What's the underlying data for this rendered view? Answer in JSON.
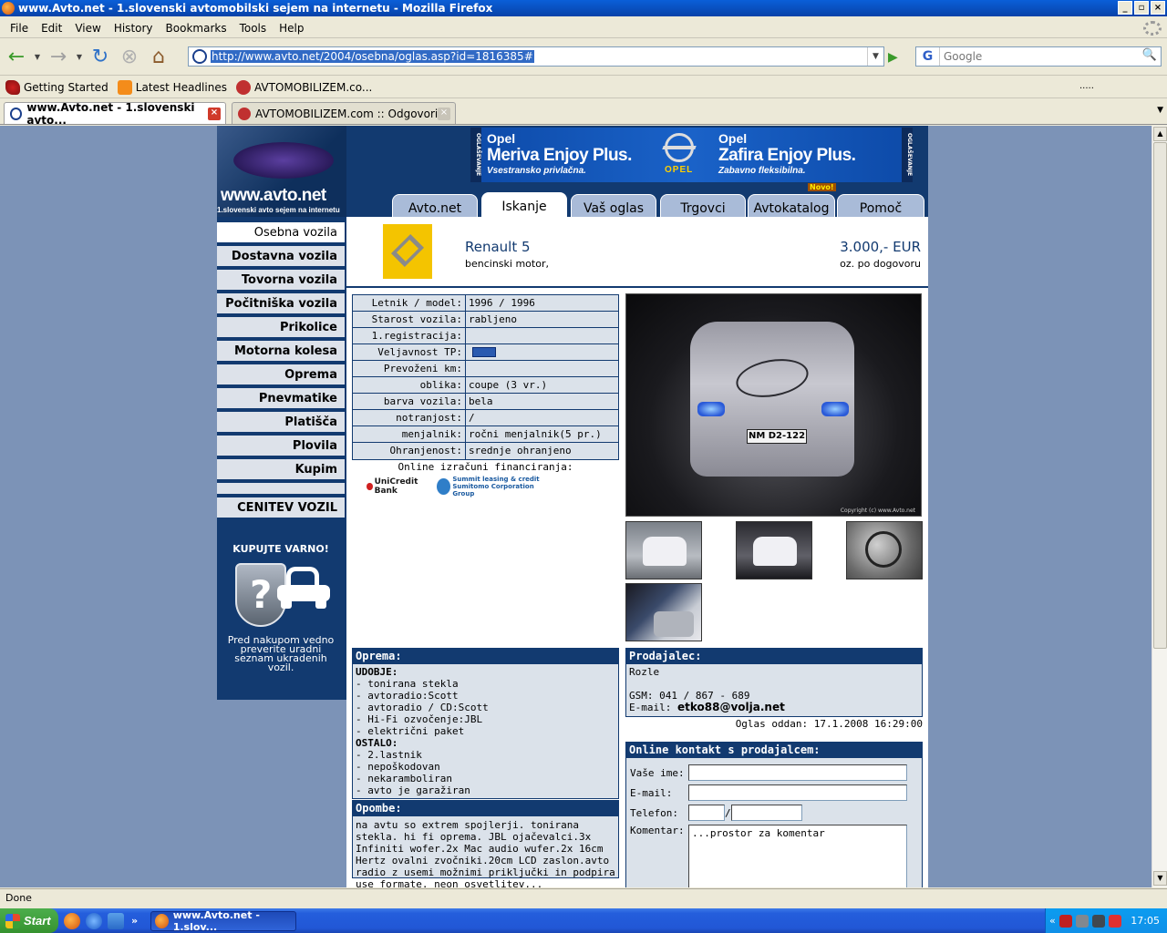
{
  "window": {
    "title": "www.Avto.net - 1.slovenski avtomobilski sejem na internetu - Mozilla Firefox",
    "min": "_",
    "max": "▫",
    "close": "×"
  },
  "menu": [
    "File",
    "Edit",
    "View",
    "History",
    "Bookmarks",
    "Tools",
    "Help"
  ],
  "nav": {
    "url": "http://www.avto.net/2004/osebna/oglas.asp?id=1816385#",
    "search_placeholder": "Google"
  },
  "bookmarks": [
    "Getting Started",
    "Latest Headlines",
    "AVTOMOBILIZEM.co..."
  ],
  "bookmarks_more": ".....",
  "browser_tabs": [
    {
      "label": "www.Avto.net - 1.slovenski avto...",
      "active": true
    },
    {
      "label": "AVTOMOBILIZEM.com :: Odgovori",
      "active": false
    }
  ],
  "site": {
    "logo_title": "www.avto.net",
    "logo_sub": "1.slovenski avto sejem na internetu",
    "banner": {
      "side_label": "OGLAŠEVANJE",
      "left": {
        "brand": "Opel",
        "model": "Meriva Enjoy Plus.",
        "tagline": "Vsestransko privlačna."
      },
      "right": {
        "brand": "Opel",
        "model": "Zafira Enjoy Plus.",
        "tagline": "Zabavno fleksibilna."
      },
      "logo_text": "OPEL"
    },
    "tabs": [
      "Avto.net",
      "Iskanje",
      "Vaš oglas",
      "Trgovci",
      "Avtokatalog",
      "Pomoč"
    ],
    "nova_badge": "Novo!",
    "sidebar": [
      "Osebna vozila",
      "Dostavna vozila",
      "Tovorna vozila",
      "Počitniška vozila",
      "Prikolice",
      "Motorna kolesa",
      "Oprema",
      "Pnevmatike",
      "Platišča",
      "Plovila",
      "Kupim",
      "",
      "CENITEV VOZIL"
    ],
    "promo": {
      "title": "KUPUJTE VARNO!",
      "text": "Pred nakupom vedno preverite uradni seznam ukradenih vozil."
    }
  },
  "listing": {
    "title": "Renault 5",
    "subtitle": "bencinski motor,",
    "price": "3.000,- EUR",
    "price_note": "oz. po dogovoru",
    "specs": [
      {
        "label": "Letnik / model:",
        "value": "1996 / 1996"
      },
      {
        "label": "Starost vozila:",
        "value": "rabljeno"
      },
      {
        "label": "1.registracija:",
        "value": ""
      },
      {
        "label": "Veljavnost TP:",
        "value": ""
      },
      {
        "label": "Prevoženi km:",
        "value": ""
      },
      {
        "label": "oblika:",
        "value": "coupe (3 vr.)"
      },
      {
        "label": "barva vozila:",
        "value": "bela"
      },
      {
        "label": "notranjost:",
        "value": "/"
      },
      {
        "label": "menjalnik:",
        "value": "ročni menjalnik(5 pr.)"
      },
      {
        "label": "Ohranjenost:",
        "value": "srednje ohranjeno"
      }
    ],
    "financing_title": "Online izračuni financiranja:",
    "financing_banks": {
      "unicredit": "UniCredit Bank",
      "summit_1": "Summit leasing & credit",
      "summit_2": "Sumitomo Corporation Group"
    },
    "photo_plate": "NM  D2-122",
    "photo_copyright": "Copyright (c) www.Avto.net",
    "oprema": {
      "heading": "Oprema:",
      "group1_title": "UDOBJE:",
      "group1": [
        "- tonirana stekla",
        "- avtoradio:Scott",
        "- avtoradio / CD:Scott",
        "- Hi-Fi ozvočenje:JBL",
        "- električni paket"
      ],
      "group2_title": "OSTALO:",
      "group2": [
        "- 2.lastnik",
        "- nepoškodovan",
        "- nekaramboliran",
        "- avto je garažiran"
      ]
    },
    "opombe": {
      "heading": "Opombe:",
      "text": "na avtu so extrem spojlerji. tonirana stekla. hi fi oprema. JBL ojačevalci.3x Infiniti wofer.2x Mac audio wufer.2x 16cm Hertz ovalni zvočniki.20cm LCD zaslon.avto radio z usemi možnimi priključki in podpira use formate. neon osvetlitev..."
    },
    "seller": {
      "heading": "Prodajalec:",
      "name": "Rozle",
      "gsm": "GSM: 041 / 867 - 689",
      "email_label": "E-mail:",
      "email": "etko88@volja.net"
    },
    "posted": "Oglas oddan: 17.1.2008 16:29:00",
    "contact": {
      "heading": "Online kontakt s prodajalcem:",
      "name_label": "Vaše ime:",
      "email_label": "E-mail:",
      "phone_label": "Telefon:",
      "phone_sep": "/",
      "comment_label": "Komentar:",
      "comment_value": "...prostor za komentar"
    }
  },
  "status": "Done",
  "taskbar": {
    "start": "Start",
    "quicklaunch_more": "»",
    "task": "www.Avto.net - 1.slov...",
    "tray_more": "«",
    "clock": "17:05"
  }
}
